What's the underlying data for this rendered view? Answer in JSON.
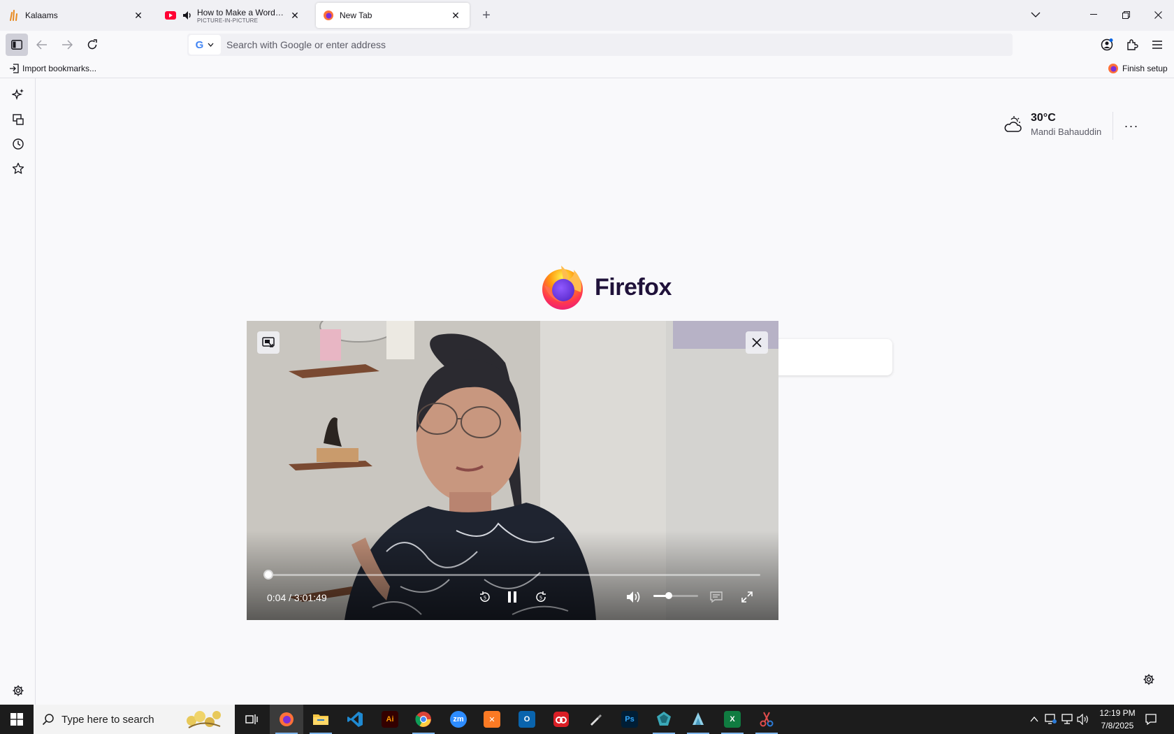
{
  "tabs": [
    {
      "title": "Kalaams",
      "subtitle": "",
      "active": false
    },
    {
      "title": "How to Make a WordPress Website",
      "subtitle": "PICTURE-IN-PICTURE",
      "active": false
    },
    {
      "title": "New Tab",
      "subtitle": "",
      "active": true
    }
  ],
  "urlbar": {
    "placeholder": "Search with Google or enter address"
  },
  "bookmarks": {
    "import_label": "Import bookmarks...",
    "finish_setup_label": "Finish setup"
  },
  "weather": {
    "temperature": "30°C",
    "location": "Mandi Bahauddin",
    "condition_icon": "partly-cloudy-icon"
  },
  "newtab": {
    "logo_wordmark": "Firefox"
  },
  "pip": {
    "current_time": "0:04",
    "duration": "3:01:49",
    "time_display": "0:04 / 3:01:49",
    "progress_fraction": 0.0004,
    "volume_fraction": 0.35
  },
  "taskbar": {
    "search_placeholder": "Type here to search",
    "time": "12:19 PM",
    "date": "7/8/2025",
    "apps": [
      "Task View",
      "Firefox",
      "File Explorer",
      "Visual Studio Code",
      "Adobe Illustrator",
      "Google Chrome",
      "Zoom",
      "XAMPP",
      "Outlook",
      "Adobe Creative Cloud",
      "Inkscape",
      "Photoshop",
      "App",
      "App",
      "Excel",
      "Snipping Tool"
    ]
  },
  "colors": {
    "accent": "#0061e0",
    "taskbar_bg": "#1c1c1c",
    "sidebar_toggle_active": "#cfcfd8"
  }
}
